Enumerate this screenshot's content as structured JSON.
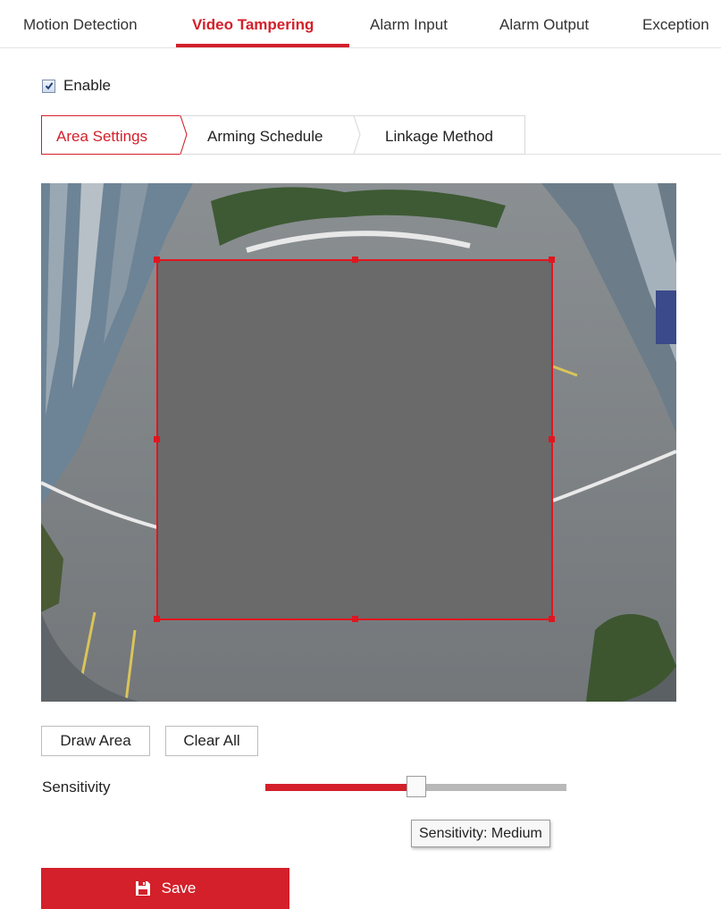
{
  "top_tabs": [
    {
      "label": "Motion Detection"
    },
    {
      "label": "Video Tampering"
    },
    {
      "label": "Alarm Input"
    },
    {
      "label": "Alarm Output"
    },
    {
      "label": "Exception"
    }
  ],
  "active_top_tab": "Video Tampering",
  "enable": {
    "label": "Enable",
    "checked": true
  },
  "sub_tabs": [
    {
      "label": "Area Settings"
    },
    {
      "label": "Arming Schedule"
    },
    {
      "label": "Linkage Method"
    }
  ],
  "active_sub_tab": "Area Settings",
  "buttons": {
    "draw_area": "Draw Area",
    "clear_all": "Clear All",
    "save": "Save"
  },
  "sensitivity": {
    "label": "Sensitivity",
    "level": 0.5,
    "tooltip": "Sensitivity: Medium"
  },
  "colors": {
    "accent": "#d3202a",
    "area_border": "#e0161f",
    "area_fill": "#6a6a6a"
  },
  "icons": {
    "save": "floppy-disk-icon",
    "checkbox": "checkmark-icon"
  }
}
